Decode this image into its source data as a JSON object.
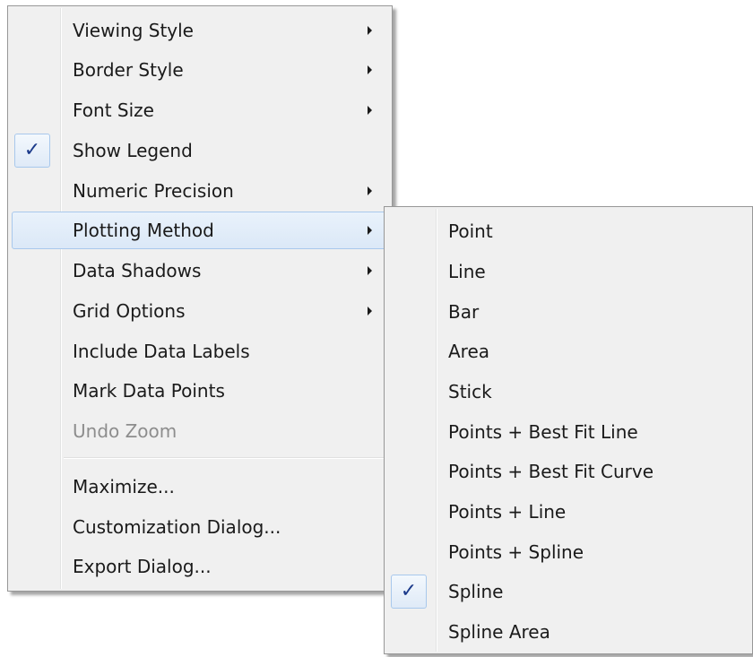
{
  "main_menu": {
    "items": [
      {
        "label": "Viewing Style"
      },
      {
        "label": "Border Style"
      },
      {
        "label": "Font Size"
      },
      {
        "label": "Show Legend"
      },
      {
        "label": "Numeric Precision"
      },
      {
        "label": "Plotting Method"
      },
      {
        "label": "Data Shadows"
      },
      {
        "label": "Grid Options"
      },
      {
        "label": "Include Data Labels"
      },
      {
        "label": "Mark Data Points"
      },
      {
        "label": "Undo Zoom"
      },
      {
        "label": "Maximize..."
      },
      {
        "label": "Customization Dialog..."
      },
      {
        "label": "Export Dialog..."
      }
    ],
    "checked_item": "Show Legend",
    "highlighted_item": "Plotting Method",
    "disabled_item": "Undo Zoom"
  },
  "sub_menu": {
    "items": [
      {
        "label": "Point"
      },
      {
        "label": "Line"
      },
      {
        "label": "Bar"
      },
      {
        "label": "Area"
      },
      {
        "label": "Stick"
      },
      {
        "label": "Points + Best Fit Line"
      },
      {
        "label": "Points + Best Fit Curve"
      },
      {
        "label": "Points + Line"
      },
      {
        "label": "Points + Spline"
      },
      {
        "label": "Spline"
      },
      {
        "label": "Spline Area"
      }
    ],
    "checked_item": "Spline"
  },
  "check_glyph": "✓",
  "icons": {
    "check": "checkmark-icon",
    "submenu": "submenu-arrow-icon"
  },
  "colors": {
    "menu_background": "#f0f0f0",
    "highlight_background": "#dbe8f7",
    "highlight_border": "#a8c8ec",
    "check_color": "#1b3a8a",
    "disabled_text": "#8d8d8d"
  }
}
